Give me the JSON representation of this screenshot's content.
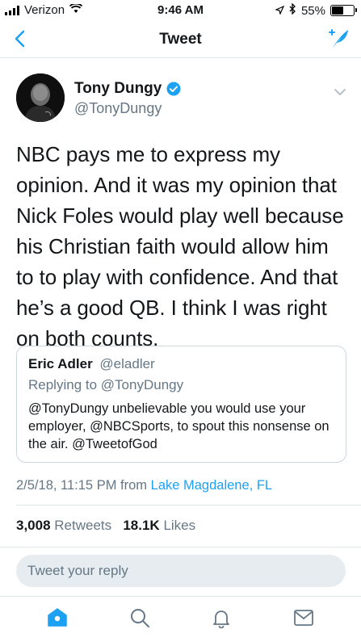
{
  "status_bar": {
    "carrier": "Verizon",
    "time": "9:46 AM",
    "battery": "55%",
    "battery_level": 0.55
  },
  "nav": {
    "title": "Tweet",
    "back_icon": "chevron-left-icon",
    "compose_icon": "compose-tweet-icon"
  },
  "tweet": {
    "author_name": "Tony Dungy",
    "author_handle": "@TonyDungy",
    "verified": true,
    "text": "NBC pays me to express my opinion. And it was my opinion that Nick Foles would play well because his Christian faith would allow him to to play with confidence. And that he’s a good QB. I think I was right on both counts.",
    "quoted": {
      "name": "Eric Adler",
      "handle": "@eladler",
      "replying_prefix": "Replying to",
      "replying_to": "@TonyDungy",
      "text": "@TonyDungy unbelievable you would use your employer, @NBCSports, to spout this nonsense on the air.  @TweetofGod"
    },
    "timestamp": "2/5/18, 11:15 PM",
    "from_label": "from",
    "location": "Lake Magdalene, FL",
    "retweets_count": "3,008",
    "retweets_label": "Retweets",
    "likes_count": "18.1K",
    "likes_label": "Likes"
  },
  "reply": {
    "placeholder": "Tweet your reply"
  },
  "tabs": [
    {
      "icon": "home-icon"
    },
    {
      "icon": "search-icon"
    },
    {
      "icon": "notifications-icon"
    },
    {
      "icon": "messages-icon"
    }
  ],
  "colors": {
    "accent": "#1da1f2",
    "text": "#14171a",
    "secondary": "#657786",
    "divider": "#e1e8ed"
  }
}
